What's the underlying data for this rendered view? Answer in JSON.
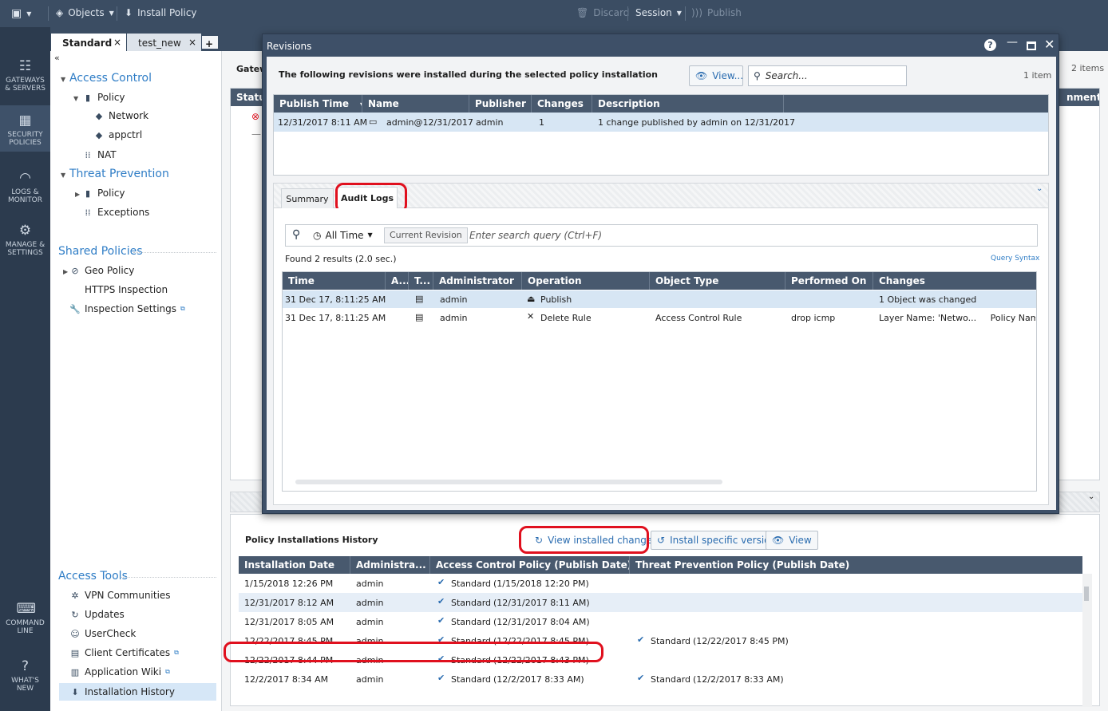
{
  "topbar": {
    "menu_icon": "app-menu-icon",
    "objects": "Objects",
    "install_policy": "Install Policy",
    "discard": "Discard",
    "session": "Session",
    "publish": "Publish"
  },
  "leftnav": [
    {
      "name": "GATEWAYS & SERVERS",
      "line1": "GATEWAYS",
      "line2": "& SERVERS",
      "icon": "servers-icon"
    },
    {
      "name": "SECURITY POLICIES",
      "line1": "SECURITY",
      "line2": "POLICIES",
      "icon": "policies-icon"
    },
    {
      "name": "LOGS & MONITOR",
      "line1": "LOGS &",
      "line2": "MONITOR",
      "icon": "gauge-icon"
    },
    {
      "name": "MANAGE & SETTINGS",
      "line1": "MANAGE &",
      "line2": "SETTINGS",
      "icon": "gear-icon"
    },
    {
      "name": "COMMAND LINE",
      "line1": "COMMAND",
      "line2": "LINE",
      "icon": "terminal-icon"
    },
    {
      "name": "WHAT'S NEW",
      "line1": "WHAT'S",
      "line2": "NEW",
      "icon": "help-icon"
    }
  ],
  "doc_tabs": {
    "standard": "Standard",
    "test_new": "test_new",
    "close": "×",
    "add": "+"
  },
  "tree": {
    "access_control": "Access Control",
    "policy": "Policy",
    "network": "Network",
    "appctrl": "appctrl",
    "nat": "NAT",
    "threat_prevention": "Threat Prevention",
    "tp_policy": "Policy",
    "exceptions": "Exceptions",
    "shared_policies": "Shared Policies",
    "geo_policy": "Geo Policy",
    "https_inspection": "HTTPS Inspection",
    "inspection_settings": "Inspection Settings",
    "access_tools": "Access Tools",
    "vpn_communities": "VPN Communities",
    "updates": "Updates",
    "usercheck": "UserCheck",
    "client_certificates": "Client Certificates",
    "application_wiki": "Application Wiki",
    "installation_history": "Installation History"
  },
  "background": {
    "gateway_col": "Gatew",
    "status_col": "Statu",
    "comments_col": "nments",
    "items_count": "2 items"
  },
  "dialog": {
    "title": "Revisions",
    "description": "The following revisions were installed during the selected policy installation",
    "view_button": "View...",
    "search_placeholder": "Search...",
    "count": "1 item",
    "columns": [
      "Publish Time",
      "Name",
      "Publisher",
      "Changes",
      "Description"
    ],
    "rows": [
      {
        "publish_time": "12/31/2017 8:11 AM",
        "name": "admin@12/31/2017",
        "publisher": "admin",
        "changes": "1",
        "description": "1 change published by admin on 12/31/2017"
      }
    ],
    "tabs": [
      "Summary",
      "Audit Logs"
    ],
    "audit": {
      "time_filter": "All Time",
      "current_revision": "Current Revision",
      "query_placeholder": "Enter search query (Ctrl+F)",
      "found": "Found 2 results (2.0 sec.)",
      "query_syntax": "Query Syntax",
      "columns": [
        "Time",
        "A...",
        "T...",
        "Administrator",
        "Operation",
        "Object Type",
        "Performed On",
        "Changes"
      ],
      "rows": [
        {
          "time": "31 Dec 17, 8:11:25 AM",
          "admin": "admin",
          "operation": "Publish",
          "object_type": "",
          "performed_on": "",
          "changes": "1 Object was changed"
        },
        {
          "time": "31 Dec 17, 8:11:25 AM",
          "admin": "admin",
          "operation": "Delete Rule",
          "object_type": "Access Control Rule",
          "performed_on": "drop icmp",
          "changes": "Layer Name: 'Netwo...     Policy Names: 'S"
        }
      ]
    }
  },
  "history": {
    "title": "Policy Installations History",
    "view_installed_changes": "View installed changes",
    "install_specific_version": "Install specific version",
    "view": "View",
    "columns": [
      "Installation Date",
      "Administra...",
      "Access Control Policy (Publish Date)",
      "Threat Prevention Policy (Publish Date)"
    ],
    "rows": [
      {
        "date": "1/15/2018 12:26 PM",
        "admin": "admin",
        "ac": "Standard",
        "ac_date": "(1/15/2018 12:20 PM)",
        "tp": "",
        "tp_date": ""
      },
      {
        "date": "12/31/2017 8:12 AM",
        "admin": "admin",
        "ac": "Standard",
        "ac_date": "(12/31/2017 8:11 AM)",
        "tp": "",
        "tp_date": ""
      },
      {
        "date": "12/31/2017 8:05 AM",
        "admin": "admin",
        "ac": "Standard",
        "ac_date": "(12/31/2017 8:04 AM)",
        "tp": "",
        "tp_date": ""
      },
      {
        "date": "12/22/2017 8:45 PM",
        "admin": "admin",
        "ac": "Standard",
        "ac_date": "(12/22/2017 8:45 PM)",
        "tp": "Standard",
        "tp_date": "(12/22/2017 8:45 PM)"
      },
      {
        "date": "12/22/2017 8:44 PM",
        "admin": "admin",
        "ac": "Standard",
        "ac_date": "(12/22/2017 8:43 PM)",
        "tp": "",
        "tp_date": ""
      },
      {
        "date": "12/2/2017 8:34 AM",
        "admin": "admin",
        "ac": "Standard",
        "ac_date": "(12/2/2017 8:33 AM)",
        "tp": "Standard",
        "tp_date": "(12/2/2017 8:33 AM)"
      }
    ]
  },
  "colors": {
    "accent": "#2f7dc6",
    "highlight": "#e0101e",
    "nav_bg": "#2c3b4e",
    "topbar_bg": "#3b4d63"
  }
}
